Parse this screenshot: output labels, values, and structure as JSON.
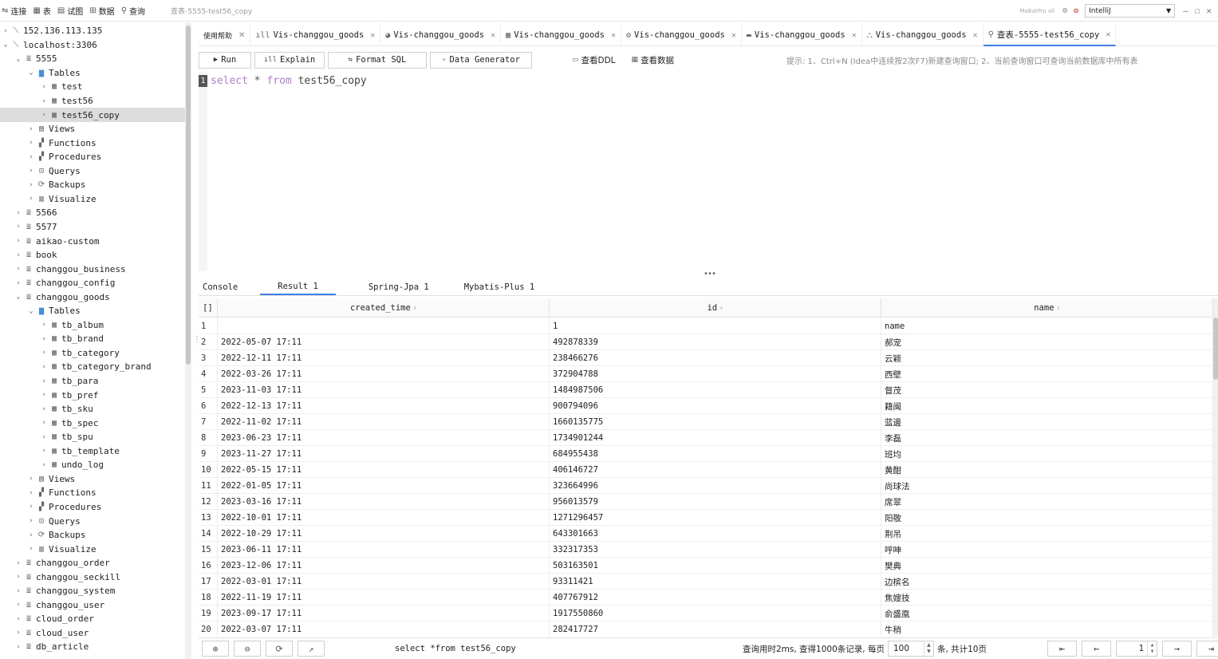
{
  "topbar": {
    "menu": [
      {
        "label": "连接",
        "icon": "connect-icon",
        "glyph": "⇋"
      },
      {
        "label": "表",
        "icon": "table-icon",
        "glyph": "▦"
      },
      {
        "label": "试图",
        "icon": "view-icon",
        "glyph": "▤"
      },
      {
        "label": "数据",
        "icon": "data-icon",
        "glyph": "⊞"
      },
      {
        "label": "查询",
        "icon": "query-icon",
        "glyph": "⚲"
      }
    ],
    "doc_title": "查表-5555-test56_copy",
    "brand": "MaBatPro all",
    "theme": "IntelliJ"
  },
  "sidebar": {
    "rows": [
      {
        "indent": 0,
        "chev": "›",
        "icon": "server-icon",
        "glyph": "⟍",
        "label": "152.136.113.135"
      },
      {
        "indent": 0,
        "chev": "⌄",
        "icon": "server-icon",
        "glyph": "⟍",
        "label": "localhost:3306"
      },
      {
        "indent": 1,
        "chev": "⌄",
        "icon": "database-icon",
        "glyph": "≣",
        "label": "5555"
      },
      {
        "indent": 2,
        "chev": "⌄",
        "icon": "folder-icon",
        "glyph": "▆",
        "label": "Tables",
        "folder": true
      },
      {
        "indent": 3,
        "chev": "›",
        "icon": "table-icon",
        "glyph": "▦",
        "label": "test"
      },
      {
        "indent": 3,
        "chev": "›",
        "icon": "table-icon",
        "glyph": "▦",
        "label": "test56"
      },
      {
        "indent": 3,
        "chev": "›",
        "icon": "table-icon",
        "glyph": "▦",
        "label": "test56_copy",
        "selected": true
      },
      {
        "indent": 2,
        "chev": "›",
        "icon": "views-icon",
        "glyph": "▤",
        "label": "Views"
      },
      {
        "indent": 2,
        "chev": "›",
        "icon": "functions-icon",
        "glyph": "▞",
        "label": "Functions"
      },
      {
        "indent": 2,
        "chev": "›",
        "icon": "procedures-icon",
        "glyph": "▞",
        "label": "Procedures"
      },
      {
        "indent": 2,
        "chev": "›",
        "icon": "querys-icon",
        "glyph": "⊡",
        "label": "Querys"
      },
      {
        "indent": 2,
        "chev": "›",
        "icon": "backups-icon",
        "glyph": "⟳",
        "label": "Backups"
      },
      {
        "indent": 2,
        "chev": "›",
        "icon": "visualize-icon",
        "glyph": "▥",
        "label": "Visualize"
      },
      {
        "indent": 1,
        "chev": "›",
        "icon": "database-icon",
        "glyph": "≣",
        "label": "5566"
      },
      {
        "indent": 1,
        "chev": "›",
        "icon": "database-icon",
        "glyph": "≣",
        "label": "5577"
      },
      {
        "indent": 1,
        "chev": "›",
        "icon": "database-icon",
        "glyph": "≣",
        "label": "aikao-custom"
      },
      {
        "indent": 1,
        "chev": "›",
        "icon": "database-icon",
        "glyph": "≣",
        "label": "book"
      },
      {
        "indent": 1,
        "chev": "›",
        "icon": "database-icon",
        "glyph": "≣",
        "label": "changgou_business"
      },
      {
        "indent": 1,
        "chev": "›",
        "icon": "database-icon",
        "glyph": "≣",
        "label": "changgou_config"
      },
      {
        "indent": 1,
        "chev": "⌄",
        "icon": "database-icon",
        "glyph": "≣",
        "label": "changgou_goods"
      },
      {
        "indent": 2,
        "chev": "⌄",
        "icon": "folder-icon",
        "glyph": "▆",
        "label": "Tables",
        "folder": true
      },
      {
        "indent": 3,
        "chev": "›",
        "icon": "table-icon",
        "glyph": "▦",
        "label": "tb_album"
      },
      {
        "indent": 3,
        "chev": "›",
        "icon": "table-icon",
        "glyph": "▦",
        "label": "tb_brand"
      },
      {
        "indent": 3,
        "chev": "›",
        "icon": "table-icon",
        "glyph": "▦",
        "label": "tb_category"
      },
      {
        "indent": 3,
        "chev": "›",
        "icon": "table-icon",
        "glyph": "▦",
        "label": "tb_category_brand"
      },
      {
        "indent": 3,
        "chev": "›",
        "icon": "table-icon",
        "glyph": "▦",
        "label": "tb_para"
      },
      {
        "indent": 3,
        "chev": "›",
        "icon": "table-icon",
        "glyph": "▦",
        "label": "tb_pref"
      },
      {
        "indent": 3,
        "chev": "›",
        "icon": "table-icon",
        "glyph": "▦",
        "label": "tb_sku"
      },
      {
        "indent": 3,
        "chev": "›",
        "icon": "table-icon",
        "glyph": "▦",
        "label": "tb_spec"
      },
      {
        "indent": 3,
        "chev": "›",
        "icon": "table-icon",
        "glyph": "▦",
        "label": "tb_spu"
      },
      {
        "indent": 3,
        "chev": "›",
        "icon": "table-icon",
        "glyph": "▦",
        "label": "tb_template"
      },
      {
        "indent": 3,
        "chev": "›",
        "icon": "table-icon",
        "glyph": "▦",
        "label": "undo_log"
      },
      {
        "indent": 2,
        "chev": "›",
        "icon": "views-icon",
        "glyph": "▤",
        "label": "Views"
      },
      {
        "indent": 2,
        "chev": "›",
        "icon": "functions-icon",
        "glyph": "▞",
        "label": "Functions"
      },
      {
        "indent": 2,
        "chev": "›",
        "icon": "procedures-icon",
        "glyph": "▞",
        "label": "Procedures"
      },
      {
        "indent": 2,
        "chev": "›",
        "icon": "querys-icon",
        "glyph": "⊡",
        "label": "Querys"
      },
      {
        "indent": 2,
        "chev": "›",
        "icon": "backups-icon",
        "glyph": "⟳",
        "label": "Backups"
      },
      {
        "indent": 2,
        "chev": "›",
        "icon": "visualize-icon",
        "glyph": "▥",
        "label": "Visualize"
      },
      {
        "indent": 1,
        "chev": "›",
        "icon": "database-icon",
        "glyph": "≣",
        "label": "changgou_order"
      },
      {
        "indent": 1,
        "chev": "›",
        "icon": "database-icon",
        "glyph": "≣",
        "label": "changgou_seckill"
      },
      {
        "indent": 1,
        "chev": "›",
        "icon": "database-icon",
        "glyph": "≣",
        "label": "changgou_system"
      },
      {
        "indent": 1,
        "chev": "›",
        "icon": "database-icon",
        "glyph": "≣",
        "label": "changgou_user"
      },
      {
        "indent": 1,
        "chev": "›",
        "icon": "database-icon",
        "glyph": "≣",
        "label": "cloud_order"
      },
      {
        "indent": 1,
        "chev": "›",
        "icon": "database-icon",
        "glyph": "≣",
        "label": "cloud_user"
      },
      {
        "indent": 1,
        "chev": "›",
        "icon": "database-icon",
        "glyph": "≣",
        "label": "db_article"
      }
    ]
  },
  "editor_tabs": [
    {
      "label": "使用帮助",
      "icon": "",
      "glyph": "",
      "help": true
    },
    {
      "label": "Vis-changgou_goods",
      "icon": "bar-chart-icon",
      "glyph": "ıll"
    },
    {
      "label": "Vis-changgou_goods",
      "icon": "pie-chart-icon",
      "glyph": "◕"
    },
    {
      "label": "Vis-changgou_goods",
      "icon": "grid-chart-icon",
      "glyph": "▦"
    },
    {
      "label": "Vis-changgou_goods",
      "icon": "gear-chart-icon",
      "glyph": "⚙"
    },
    {
      "label": "Vis-changgou_goods",
      "icon": "area-chart-icon",
      "glyph": "▬"
    },
    {
      "label": "Vis-changgou_goods",
      "icon": "tree-chart-icon",
      "glyph": "⛬"
    },
    {
      "label": "查表-5555-test56_copy",
      "icon": "query-icon",
      "glyph": "⚲",
      "active": true
    }
  ],
  "toolbar": {
    "run": "Run",
    "explain": "Explain",
    "format_sql": "Format SQL",
    "data_generator": "Data Generator",
    "view_ddl": "查看DDL",
    "view_data": "查看数据",
    "hint": "提示: 1、Ctrl+N (Idea中连续按2次F7)新建查询窗口;  2、当前查询窗口可查询当前数据库中所有表"
  },
  "editor": {
    "line_number": "1",
    "kw_select": "select",
    "op_star": "*",
    "kw_from": "from",
    "table": "test56_copy"
  },
  "result_tabs": [
    "Console",
    "Result 1",
    "Spring-Jpa 1",
    "Mybatis-Plus 1"
  ],
  "grid": {
    "corner": "[]",
    "columns": [
      "created_time",
      "id",
      "name"
    ],
    "rows": [
      [
        "1",
        "",
        "1",
        "name"
      ],
      [
        "2",
        "2022-05-07 17:11",
        "492878339",
        "郝宠"
      ],
      [
        "3",
        "2022-12-11 17:11",
        "238466276",
        "云颖"
      ],
      [
        "4",
        "2022-03-26 17:11",
        "372904788",
        "西壁"
      ],
      [
        "5",
        "2023-11-03 17:11",
        "1484987506",
        "督茂"
      ],
      [
        "6",
        "2022-12-13 17:11",
        "900794096",
        "籍闽"
      ],
      [
        "7",
        "2022-11-02 17:11",
        "1660135775",
        "蓝邊"
      ],
      [
        "8",
        "2023-06-23 17:11",
        "1734901244",
        "李磊"
      ],
      [
        "9",
        "2023-11-27 17:11",
        "684955438",
        "班均"
      ],
      [
        "10",
        "2022-05-15 17:11",
        "406146727",
        "黄酣"
      ],
      [
        "11",
        "2022-01-05 17:11",
        "323664996",
        "尚球法"
      ],
      [
        "12",
        "2023-03-16 17:11",
        "956013579",
        "席翠"
      ],
      [
        "13",
        "2022-10-01 17:11",
        "1271296457",
        "阳敬"
      ],
      [
        "14",
        "2022-10-29 17:11",
        "643301663",
        "荆吊"
      ],
      [
        "15",
        "2023-06-11 17:11",
        "332317353",
        "呼呻"
      ],
      [
        "16",
        "2023-12-06 17:11",
        "503163501",
        "樊典"
      ],
      [
        "17",
        "2022-03-01 17:11",
        "93311421",
        "边槟名"
      ],
      [
        "18",
        "2022-11-19 17:11",
        "407767912",
        "焦嫂技"
      ],
      [
        "19",
        "2023-09-17 17:11",
        "1917550860",
        "俞盛凰"
      ],
      [
        "20",
        "2022-03-07 17:11",
        "282417727",
        "牛稍"
      ]
    ]
  },
  "bottombar": {
    "add": "⊕",
    "remove": "⊖",
    "refresh": "⟳",
    "export": "↗",
    "sql": "select *from test56_copy",
    "info_prefix": "查询用时2ms, 查得1000条记录, 每页",
    "page_size": "100",
    "info_suffix": "条, 共计10页",
    "page": "1",
    "first": "⇤",
    "prev": "←",
    "next": "→",
    "last": "⇥"
  }
}
